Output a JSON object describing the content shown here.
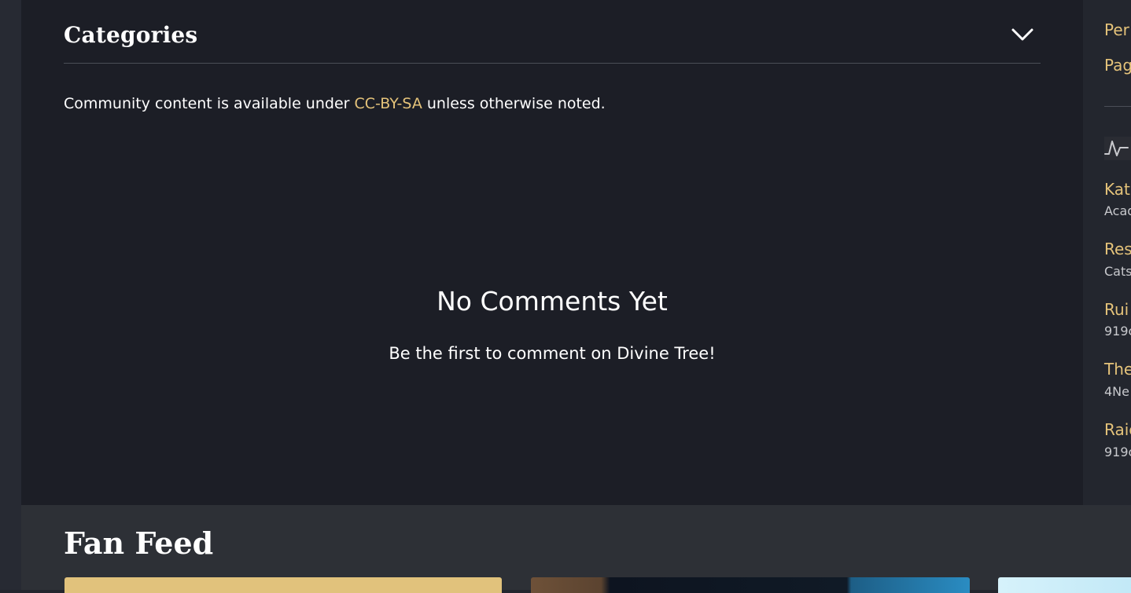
{
  "categories": {
    "title": "Categories",
    "toggle_icon": "chevron-down-icon"
  },
  "license": {
    "prefix": "Community content is available under ",
    "link": "CC-BY-SA",
    "suffix": " unless otherwise noted."
  },
  "comments": {
    "title": "No Comments Yet",
    "subtitle": "Be the first to comment on Divine Tree!"
  },
  "right_rail": {
    "links": [
      "Per",
      "Pag"
    ],
    "activity_icon": "activity-pulse-icon",
    "activity": [
      {
        "title": "Kat",
        "meta": "Acad"
      },
      {
        "title": "Res",
        "meta": "Cats"
      },
      {
        "title": "Rui",
        "meta": "919c"
      },
      {
        "title": "The",
        "meta": "4Ne"
      },
      {
        "title": "Raic",
        "meta": "919c"
      }
    ]
  },
  "fan_feed": {
    "title": "Fan Feed"
  },
  "colors": {
    "accent": "#e5c37a",
    "panel": "#1c1e26",
    "page": "#23262e",
    "fan_feed_bg": "#2d3036"
  }
}
